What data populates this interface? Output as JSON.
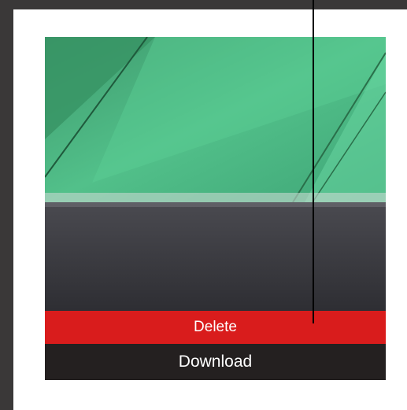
{
  "actions": {
    "delete_label": "Delete",
    "download_label": "Download"
  },
  "colors": {
    "background": "#3a3838",
    "card": "#ffffff",
    "delete": "#d91c1c",
    "download": "#242020"
  }
}
